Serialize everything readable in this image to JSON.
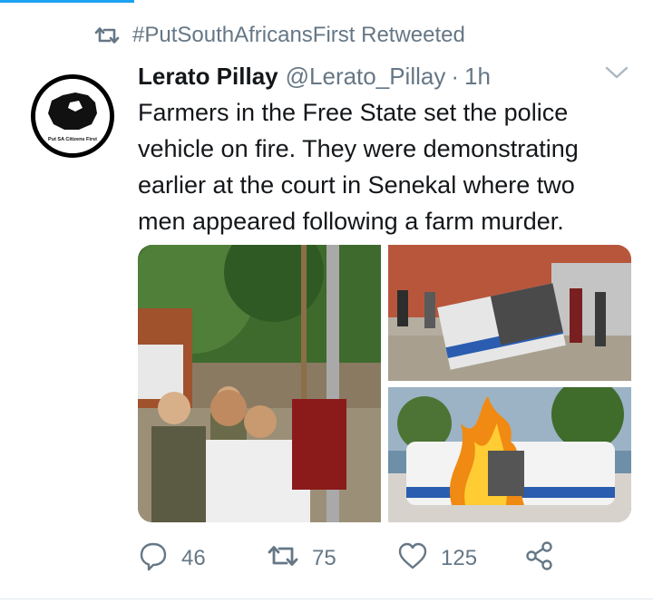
{
  "retweet_banner": {
    "icon": "retweet-icon",
    "text": "#PutSouthAfricansFirst Retweeted"
  },
  "tweet": {
    "author_name": "Lerato Pillay",
    "author_handle": "@Lerato_Pillay",
    "separator": "·",
    "time": "1h",
    "text": "Farmers in the Free State set the  police\nvehicle on fire. They were demonstrating\nearlier at the court in Senekal where two\nmen appeared following a farm murder.",
    "avatar_text": "Put SA Citizens First",
    "media": [
      {
        "name": "crowd-photo"
      },
      {
        "name": "overturned-vehicle-photo"
      },
      {
        "name": "burning-vehicle-photo"
      }
    ]
  },
  "actions": {
    "reply": {
      "icon": "reply-icon",
      "count": "46"
    },
    "retweet": {
      "icon": "retweet-icon",
      "count": "75"
    },
    "like": {
      "icon": "heart-icon",
      "count": "125"
    },
    "share": {
      "icon": "share-icon"
    }
  },
  "colors": {
    "accent": "#1da1f2",
    "muted": "#657786",
    "text": "#14171a"
  }
}
